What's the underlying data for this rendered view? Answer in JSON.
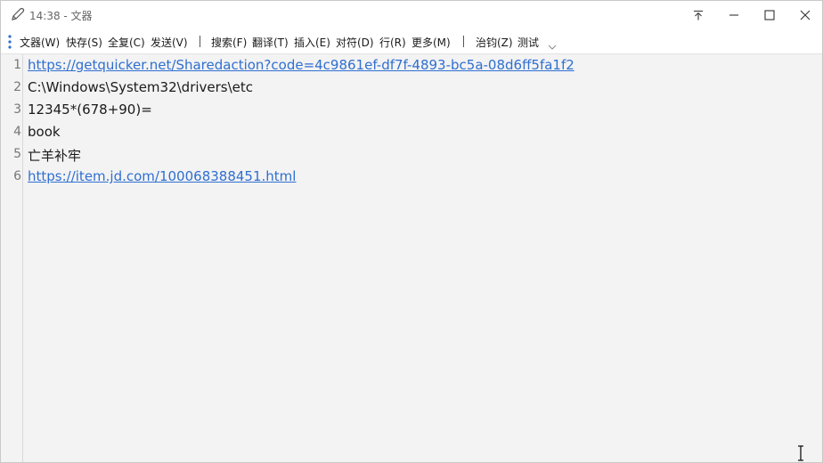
{
  "titlebar": {
    "title": "14:38 - 文器",
    "icons": [
      "pen-icon",
      "pin-icon",
      "minimize-icon",
      "maximize-icon",
      "close-icon"
    ]
  },
  "menubar": {
    "items": [
      "文器(W)",
      "快存(S)",
      "全复(C)",
      "发送(V)",
      "搜索(F)",
      "翻译(T)",
      "插入(E)",
      "对符(D)",
      "行(R)",
      "更多(M)",
      "治钧(Z)",
      "测试"
    ]
  },
  "editor": {
    "lines": [
      {
        "num": "1",
        "text": "https://getquicker.net/Sharedaction?code=4c9861ef-df7f-4893-bc5a-08d6ff5fa1f2",
        "link": true
      },
      {
        "num": "2",
        "text": "C:\\Windows\\System32\\drivers\\etc",
        "link": false
      },
      {
        "num": "3",
        "text": "12345*(678+90)=",
        "link": false
      },
      {
        "num": "4",
        "text": "book",
        "link": false
      },
      {
        "num": "5",
        "text": "亡羊补牢",
        "link": false
      },
      {
        "num": "6",
        "text": "https://item.jd.com/100068388451.html",
        "link": true
      }
    ]
  },
  "colors": {
    "link": "#2f6fd1",
    "background": "#f3f3f3",
    "grip": "#2f6fd1"
  }
}
